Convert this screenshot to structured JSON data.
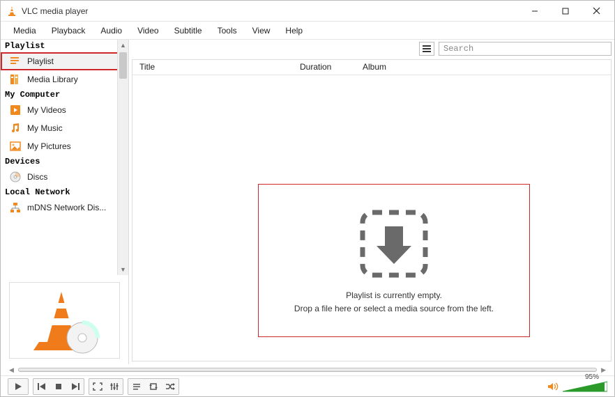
{
  "window": {
    "title": "VLC media player"
  },
  "menu": {
    "items": [
      "Media",
      "Playback",
      "Audio",
      "Video",
      "Subtitle",
      "Tools",
      "View",
      "Help"
    ]
  },
  "sidebar": {
    "sections": [
      {
        "title": "Playlist",
        "items": [
          {
            "icon": "playlist-icon",
            "label": "Playlist",
            "selected": true,
            "highlighted": true
          },
          {
            "icon": "media-library-icon",
            "label": "Media Library"
          }
        ]
      },
      {
        "title": "My Computer",
        "items": [
          {
            "icon": "video-file-icon",
            "label": "My Videos"
          },
          {
            "icon": "music-file-icon",
            "label": "My Music"
          },
          {
            "icon": "picture-file-icon",
            "label": "My Pictures"
          }
        ]
      },
      {
        "title": "Devices",
        "items": [
          {
            "icon": "disc-icon",
            "label": "Discs"
          }
        ]
      },
      {
        "title": "Local Network",
        "items": [
          {
            "icon": "network-icon",
            "label": "mDNS Network Dis..."
          }
        ]
      }
    ]
  },
  "search": {
    "placeholder": "Search"
  },
  "columns": {
    "title": "Title",
    "duration": "Duration",
    "album": "Album"
  },
  "empty": {
    "line1": "Playlist is currently empty.",
    "line2": "Drop a file here or select a media source from the left."
  },
  "volume": {
    "percent": "95%"
  },
  "controls": {
    "play": "play",
    "prev": "previous",
    "stop": "stop",
    "next": "next",
    "fullscreen": "fullscreen",
    "extended": "extended-settings",
    "playlist": "toggle-playlist",
    "loop": "loop",
    "shuffle": "shuffle",
    "speaker": "speaker"
  }
}
